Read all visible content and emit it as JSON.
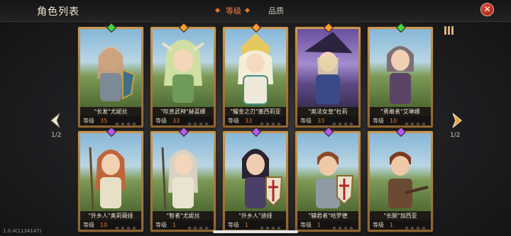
{
  "header": {
    "title": "角色列表",
    "close_symbol": "✕"
  },
  "tabs": [
    {
      "label": "等级",
      "active": true
    },
    {
      "label": "品质",
      "active": false
    }
  ],
  "pagination": {
    "left": "1/2",
    "right": "1/2"
  },
  "level_label": "等级",
  "colors": {
    "accent": "#ff7a3c",
    "gem_green": "#46d14a",
    "gem_orange": "#ff9d2e",
    "gem_purple": "#b25cf0"
  },
  "characters": [
    {
      "name": "\"长发\"尤妮丝",
      "level": "35",
      "gem": "green"
    },
    {
      "name": "\"叹息武神\"赫蓝娜",
      "level": "33",
      "gem": "orange"
    },
    {
      "name": "\"耀金之刃\"塞西莉亚",
      "level": "33",
      "gem": "orange"
    },
    {
      "name": "\"奥法女皇\"杜莉",
      "level": "33",
      "gem": "orange"
    },
    {
      "name": "\"勇敢者\"艾琳娜",
      "level": "10",
      "gem": "green"
    },
    {
      "name": "\"外乡人\"奥莉薇娅",
      "level": "10",
      "gem": "purple"
    },
    {
      "name": "\"智者\"尤妮丝",
      "level": "1",
      "gem": "purple"
    },
    {
      "name": "\"外乡人\"迪娅",
      "level": "1",
      "gem": "purple"
    },
    {
      "name": "\"辅君者\"哈罗德",
      "level": "1",
      "gem": "purple"
    },
    {
      "name": "\"长腿\"加西亚",
      "level": "1",
      "gem": "purple"
    }
  ],
  "version": "1.0.4(1134147)"
}
